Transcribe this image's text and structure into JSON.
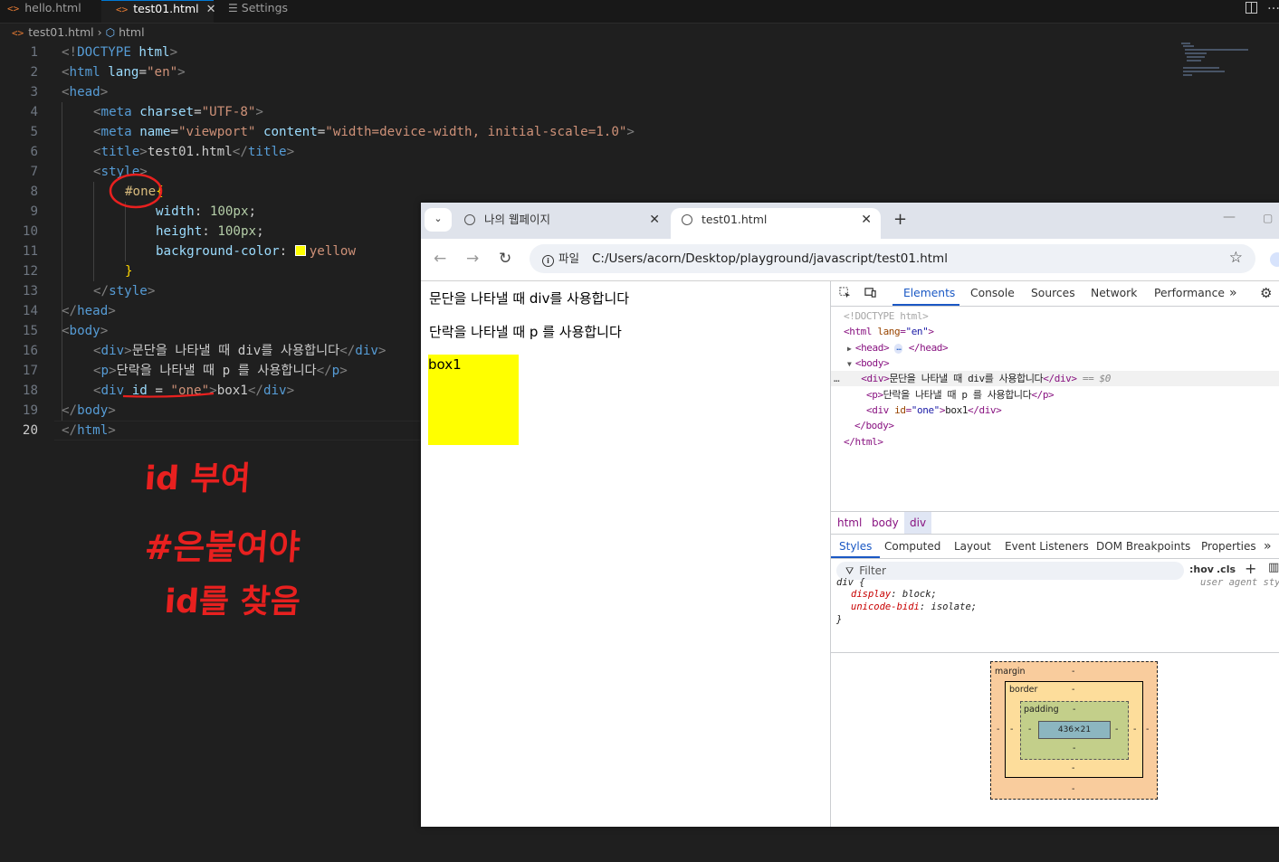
{
  "editor": {
    "tabs": [
      {
        "label": "hello.html",
        "icon": "html-file-icon"
      },
      {
        "label": "test01.html",
        "icon": "html-file-icon",
        "active": true
      },
      {
        "label": "Settings",
        "icon": "settings-icon"
      }
    ],
    "breadcrumb": {
      "file": "test01.html",
      "node": "html"
    },
    "line_numbers": [
      "1",
      "2",
      "3",
      "4",
      "5",
      "6",
      "7",
      "8",
      "9",
      "10",
      "11",
      "12",
      "13",
      "14",
      "15",
      "16",
      "17",
      "18",
      "19",
      "20"
    ],
    "lines": {
      "l1": {
        "a": "<!",
        "b": "DOCTYPE",
        "c": " html",
        "d": ">"
      },
      "l2": {
        "a": "<",
        "b": "html",
        "c": " lang",
        "d": "=",
        "e": "\"en\"",
        "f": ">"
      },
      "l3": {
        "a": "<",
        "b": "head",
        "c": ">"
      },
      "l4": {
        "a": "<",
        "b": "meta",
        "c": " charset",
        "d": "=",
        "e": "\"UTF-8\"",
        "f": ">"
      },
      "l5": {
        "a": "<",
        "b": "meta",
        "c": " name",
        "d": "=",
        "e": "\"viewport\"",
        "g": " content",
        "h": "=",
        "i": "\"width=device-width, initial-scale=1.0\"",
        "f": ">"
      },
      "l6": {
        "a": "<",
        "b": "title",
        "c": ">",
        "t": "test01.html",
        "d": "</",
        "e": "title",
        "f": ">"
      },
      "l7": {
        "a": "<",
        "b": "style",
        "c": ">"
      },
      "l8": {
        "sel": "#one",
        "br": "{"
      },
      "l9": {
        "p": "width",
        "c": ": ",
        "v": "100px",
        "s": ";"
      },
      "l10": {
        "p": "height",
        "c": ": ",
        "v": "100px",
        "s": ";"
      },
      "l11": {
        "p": "background-color",
        "c": ": ",
        "v": "yellow"
      },
      "l12": {
        "br": "}"
      },
      "l13": {
        "a": "</",
        "b": "style",
        "c": ">"
      },
      "l14": {
        "a": "</",
        "b": "head",
        "c": ">"
      },
      "l15": {
        "a": "<",
        "b": "body",
        "c": ">"
      },
      "l16": {
        "a": "<",
        "b": "div",
        "c": ">",
        "t": "문단을 나타낼 때 div를 사용합니다",
        "d": "</",
        "e": "div",
        "f": ">"
      },
      "l17": {
        "a": "<",
        "b": "p",
        "c": ">",
        "t": "단락을 나타낼 때 p 를 사용합니다",
        "d": "</",
        "e": "p",
        "f": ">"
      },
      "l18": {
        "a": "<",
        "b": "div",
        "g": " id",
        "h": " = ",
        "i": "\"one\"",
        "c": ">",
        "t": "box1",
        "d": "</",
        "e": "div",
        "f": ">"
      },
      "l19": {
        "a": "</",
        "b": "body",
        "c": ">"
      },
      "l20": {
        "a": "</",
        "b": "html",
        "c": ">"
      }
    },
    "annotation": [
      "id 부여",
      "#은붙여야",
      "id를 찾음"
    ],
    "colors": {
      "swatch": "#ffff00",
      "annotation": "#e8201f"
    }
  },
  "browser": {
    "tabs": [
      {
        "label": "나의 웹페이지"
      },
      {
        "label": "test01.html",
        "active": true
      }
    ],
    "site_chip": "파일",
    "url": "C:/Users/acorn/Desktop/playground/javascript/test01.html",
    "page": {
      "div_text": "문단을 나타낼 때 div를 사용합니다",
      "p_text": "단락을 나타낼 때 p 를 사용합니다",
      "box_text": "box1"
    },
    "devtools": {
      "tabs": [
        "Elements",
        "Console",
        "Sources",
        "Network",
        "Performance"
      ],
      "dom": {
        "doctype": "<!DOCTYPE html>",
        "html_open": "<html",
        "lang_attr": " lang",
        "lang_val": "\"en\"",
        "gt": ">",
        "head": "<head>",
        "head_close": "</head>",
        "body_open": "<body>",
        "div_open": "<div>",
        "div_text": "문단을 나타낼 때 div를 사용합니다",
        "div_close": "</div>",
        "eq0": " == $0",
        "p_open": "<p>",
        "p_text": "단락을 나타낼 때 p 를 사용합니다",
        "p_close": "</p>",
        "div2_open": "<div",
        "id_attr": " id",
        "id_val": "\"one\"",
        "box_text": "box1",
        "body_close": "</body>",
        "html_close": "</html>"
      },
      "crumbs": [
        "html",
        "body",
        "div"
      ],
      "styles_tabs": [
        "Styles",
        "Computed",
        "Layout",
        "Event Listeners",
        "DOM Breakpoints",
        "Properties"
      ],
      "filter_placeholder": "Filter",
      "hov": ":hov",
      "cls": ".cls",
      "ua_rule": {
        "selector": "div {",
        "source": "user agent sty",
        "props": [
          {
            "name": "display",
            "value": "block"
          },
          {
            "name": "unicode-bidi",
            "value": "isolate"
          }
        ],
        "close": "}"
      },
      "box_model": {
        "margin_label": "margin",
        "border_label": "border",
        "padding_label": "padding",
        "dash": "-",
        "content_size": "436×21"
      }
    }
  }
}
